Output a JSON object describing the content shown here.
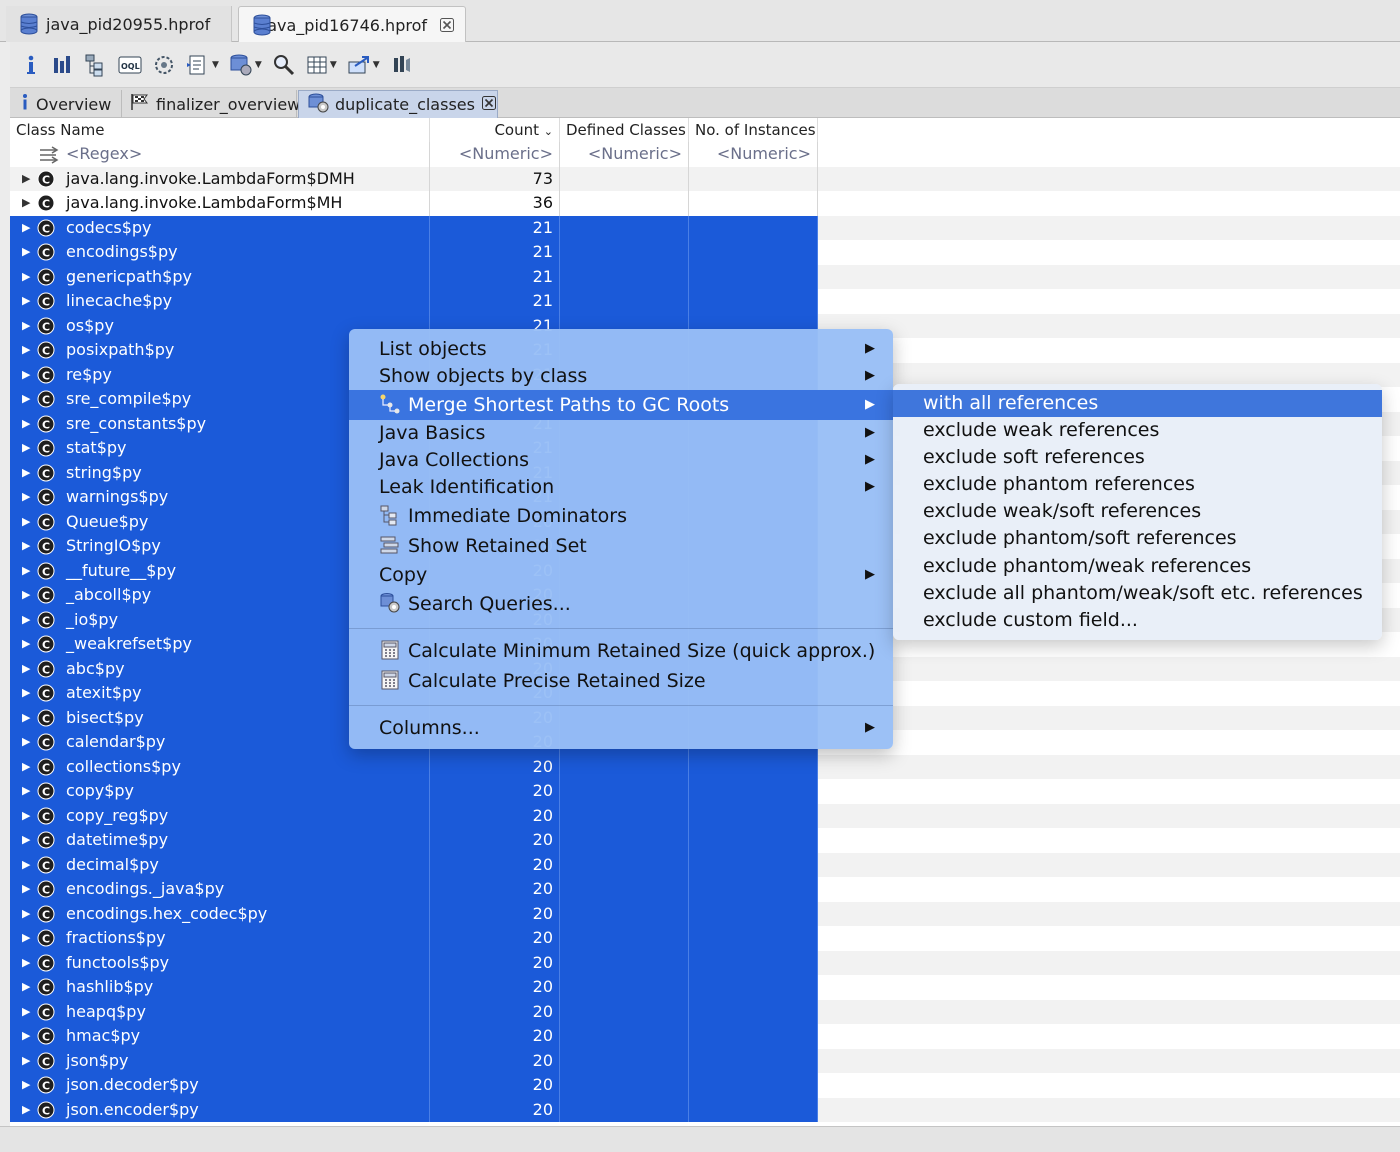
{
  "editor_tabs": [
    {
      "label": "java_pid20955.hprof",
      "active": false
    },
    {
      "label": "java_pid16746.hprof",
      "active": true
    }
  ],
  "toolbar": {
    "buttons": [
      "info-icon",
      "histogram-icon",
      "dominator-tree-icon",
      "oql-icon",
      "heap-dump-overview-icon",
      "reports-icon",
      "query-browser-icon",
      "search-icon",
      "layout-icon",
      "export-icon",
      "pin-icon"
    ]
  },
  "view_tabs": [
    {
      "label": "Overview",
      "icon": "info-icon",
      "active": false
    },
    {
      "label": "finalizer_overview",
      "icon": "flag-icon",
      "active": false
    },
    {
      "label": "duplicate_classes",
      "icon": "query-icon",
      "active": true
    }
  ],
  "table": {
    "headers": {
      "class_name": "Class Name",
      "count": "Count",
      "defined_classes": "Defined Classes",
      "instances": "No. of Instances"
    },
    "filter_row": {
      "name": "<Regex>",
      "count": "<Numeric>",
      "defined": "<Numeric>",
      "instances": "<Numeric>"
    },
    "rows": [
      {
        "name": "java.lang.invoke.LambdaForm$DMH",
        "count": "73",
        "selected": false
      },
      {
        "name": "java.lang.invoke.LambdaForm$MH",
        "count": "36",
        "selected": false
      },
      {
        "name": "codecs$py",
        "count": "21",
        "selected": true
      },
      {
        "name": "encodings$py",
        "count": "21",
        "selected": true
      },
      {
        "name": "genericpath$py",
        "count": "21",
        "selected": true
      },
      {
        "name": "linecache$py",
        "count": "21",
        "selected": true
      },
      {
        "name": "os$py",
        "count": "21",
        "selected": true
      },
      {
        "name": "posixpath$py",
        "count": "21",
        "selected": true
      },
      {
        "name": "re$py",
        "count": "21",
        "selected": true
      },
      {
        "name": "sre_compile$py",
        "count": "21",
        "selected": true
      },
      {
        "name": "sre_constants$py",
        "count": "21",
        "selected": true
      },
      {
        "name": "stat$py",
        "count": "21",
        "selected": true
      },
      {
        "name": "string$py",
        "count": "21",
        "selected": true
      },
      {
        "name": "warnings$py",
        "count": "21",
        "selected": true
      },
      {
        "name": "Queue$py",
        "count": "20",
        "selected": true
      },
      {
        "name": "StringIO$py",
        "count": "20",
        "selected": true
      },
      {
        "name": "__future__$py",
        "count": "20",
        "selected": true
      },
      {
        "name": "_abcoll$py",
        "count": "20",
        "selected": true
      },
      {
        "name": "_io$py",
        "count": "20",
        "selected": true
      },
      {
        "name": "_weakrefset$py",
        "count": "20",
        "selected": true
      },
      {
        "name": "abc$py",
        "count": "20",
        "selected": true
      },
      {
        "name": "atexit$py",
        "count": "20",
        "selected": true
      },
      {
        "name": "bisect$py",
        "count": "20",
        "selected": true
      },
      {
        "name": "calendar$py",
        "count": "20",
        "selected": true
      },
      {
        "name": "collections$py",
        "count": "20",
        "selected": true
      },
      {
        "name": "copy$py",
        "count": "20",
        "selected": true
      },
      {
        "name": "copy_reg$py",
        "count": "20",
        "selected": true
      },
      {
        "name": "datetime$py",
        "count": "20",
        "selected": true
      },
      {
        "name": "decimal$py",
        "count": "20",
        "selected": true
      },
      {
        "name": "encodings._java$py",
        "count": "20",
        "selected": true
      },
      {
        "name": "encodings.hex_codec$py",
        "count": "20",
        "selected": true
      },
      {
        "name": "fractions$py",
        "count": "20",
        "selected": true
      },
      {
        "name": "functools$py",
        "count": "20",
        "selected": true
      },
      {
        "name": "hashlib$py",
        "count": "20",
        "selected": true
      },
      {
        "name": "heapq$py",
        "count": "20",
        "selected": true
      },
      {
        "name": "hmac$py",
        "count": "20",
        "selected": true
      },
      {
        "name": "json$py",
        "count": "20",
        "selected": true
      },
      {
        "name": "json.decoder$py",
        "count": "20",
        "selected": true
      },
      {
        "name": "json.encoder$py",
        "count": "20",
        "selected": true
      }
    ]
  },
  "context_menu": {
    "items": [
      {
        "label": "List objects",
        "submenu": true
      },
      {
        "label": "Show objects by class",
        "submenu": true
      },
      {
        "label": "Merge Shortest Paths to GC Roots",
        "submenu": true,
        "highlighted": true,
        "icon": "merge-paths-icon"
      },
      {
        "label": "Java Basics",
        "submenu": true
      },
      {
        "label": "Java Collections",
        "submenu": true
      },
      {
        "label": "Leak Identification",
        "submenu": true
      },
      {
        "label": "Immediate Dominators",
        "submenu": false,
        "icon": "dominators-icon"
      },
      {
        "label": "Show Retained Set",
        "submenu": false,
        "icon": "retained-set-icon"
      },
      {
        "label": "Copy",
        "submenu": true
      },
      {
        "label": "Search Queries...",
        "submenu": false,
        "icon": "search-queries-icon"
      },
      {
        "label": "Calculate Minimum Retained Size (quick approx.)",
        "submenu": false,
        "icon": "calculator-icon"
      },
      {
        "label": "Calculate Precise Retained Size",
        "submenu": false,
        "icon": "calculator-icon"
      },
      {
        "label": "Columns...",
        "submenu": true
      }
    ]
  },
  "submenu": {
    "items": [
      {
        "label": "with all references",
        "highlighted": true
      },
      {
        "label": "exclude weak references"
      },
      {
        "label": "exclude soft references"
      },
      {
        "label": "exclude phantom references"
      },
      {
        "label": "exclude weak/soft references"
      },
      {
        "label": "exclude phantom/soft references"
      },
      {
        "label": "exclude phantom/weak references"
      },
      {
        "label": "exclude all phantom/weak/soft etc. references"
      },
      {
        "label": "exclude custom field..."
      }
    ]
  },
  "colors": {
    "selection": "#1b5ad9",
    "menu_background": "#98bef6",
    "menu_highlight": "#3a74e0",
    "submenu_background": "#e8eef8"
  }
}
